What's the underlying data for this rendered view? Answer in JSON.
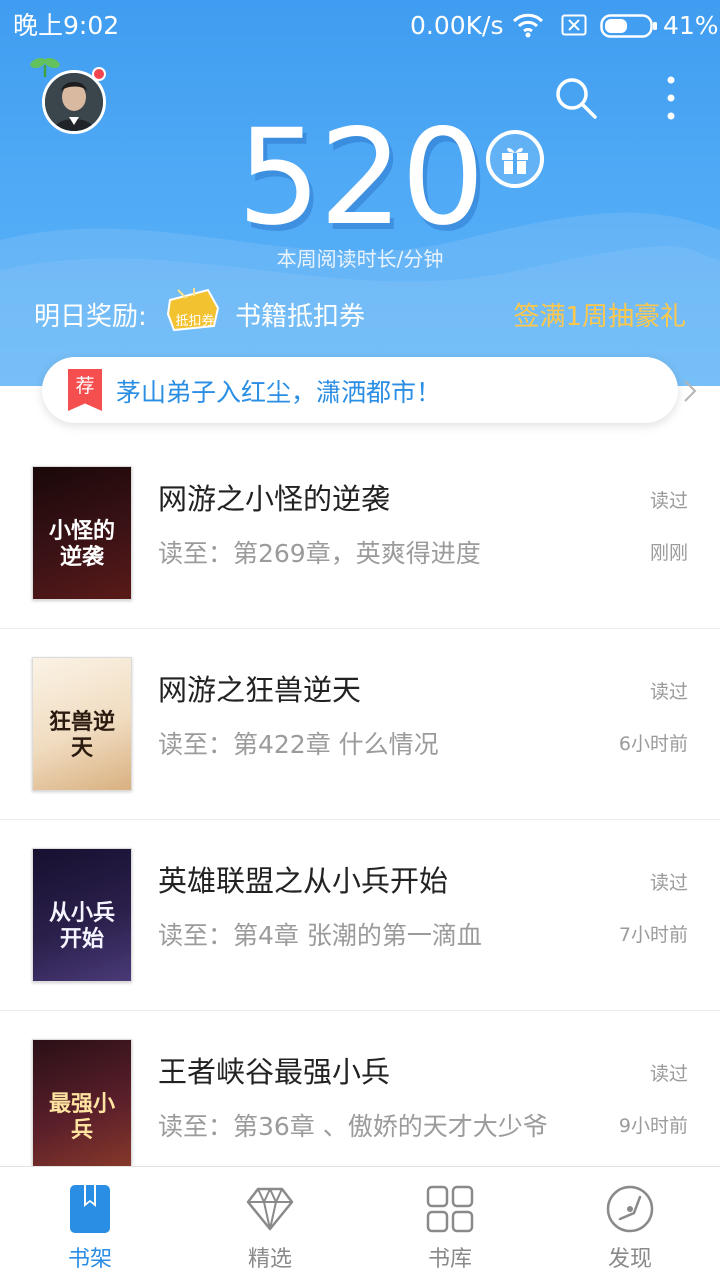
{
  "status_bar": {
    "time": "晚上9:02",
    "network_speed": "0.00K/s",
    "battery": "41%"
  },
  "header": {
    "minutes": "520",
    "minutes_label": "本周阅读时长/分钟",
    "reward_label": "明日奖励:",
    "coupon_badge": "抵扣券",
    "reward_item": "书籍抵扣券",
    "signin_link": "签满1周抽豪礼"
  },
  "banner": {
    "tag": "荐",
    "text": "茅山弟子入红尘，潇洒都市！"
  },
  "books": [
    {
      "title": "网游之小怪的逆袭",
      "progress": "读至：第269章，英爽得进度",
      "status": "读过",
      "time": "刚刚",
      "cover_text": "小怪的逆袭",
      "cover_bg": "#3a1216",
      "cover_fg": "#ffffff"
    },
    {
      "title": "网游之狂兽逆天",
      "progress": "读至：第422章 什么情况",
      "status": "读过",
      "time": "6小时前",
      "cover_text": "狂兽逆天",
      "cover_bg": "#f3e6d2",
      "cover_fg": "#2a1a10"
    },
    {
      "title": "英雄联盟之从小兵开始",
      "progress": "读至：第4章 张潮的第一滴血",
      "status": "读过",
      "time": "7小时前",
      "cover_text": "从小兵开始",
      "cover_bg": "#2a1f4a",
      "cover_fg": "#f5f5ff"
    },
    {
      "title": "王者峡谷最强小兵",
      "progress": "读至：第36章 、傲娇的天才大少爷",
      "status": "读过",
      "time": "9小时前",
      "cover_text": "最强小兵",
      "cover_bg": "#5a1f2a",
      "cover_fg": "#ffe3a0"
    }
  ],
  "nav": [
    {
      "label": "书架",
      "icon": "bookshelf-icon",
      "active": true
    },
    {
      "label": "精选",
      "icon": "diamond-icon",
      "active": false
    },
    {
      "label": "书库",
      "icon": "grid-icon",
      "active": false
    },
    {
      "label": "发现",
      "icon": "compass-icon",
      "active": false
    }
  ],
  "colors": {
    "primary": "#2a8ee4",
    "header_blue": "#4fa9f5",
    "accent_gold": "#ffc84a",
    "tag_red": "#f44e4e"
  }
}
